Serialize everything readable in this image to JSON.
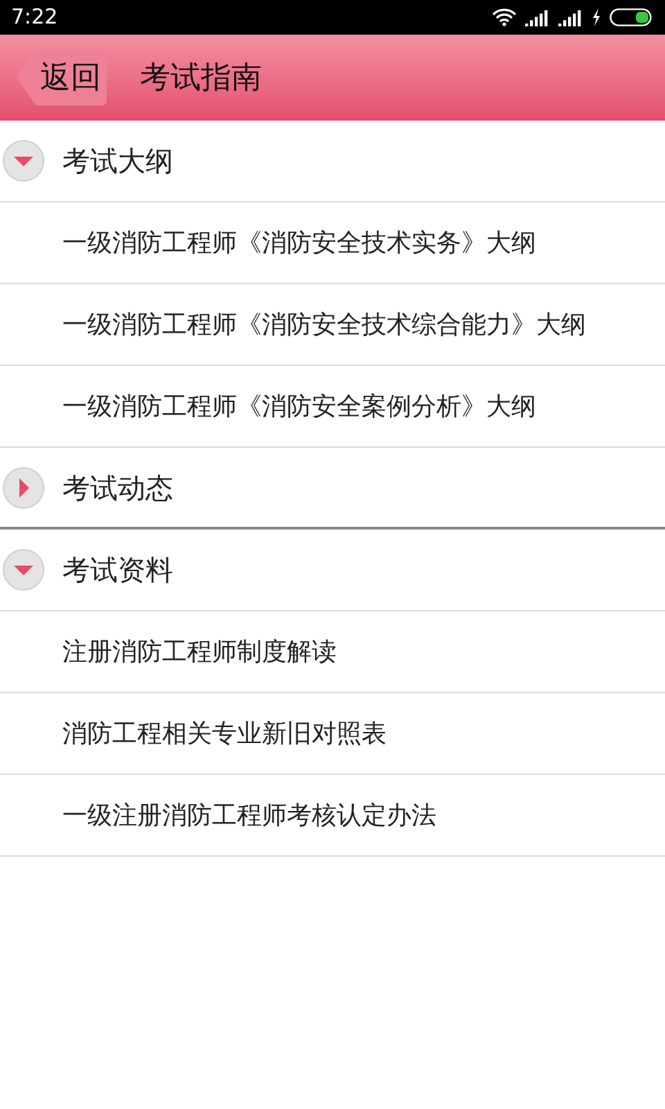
{
  "status_bar": {
    "time": "7:22"
  },
  "header": {
    "back": "返回",
    "title": "考试指南"
  },
  "groups": [
    {
      "label": "考试大纲",
      "expanded": true,
      "children": [
        {
          "label": "一级消防工程师《消防安全技术实务》大纲"
        },
        {
          "label": "一级消防工程师《消防安全技术综合能力》大纲"
        },
        {
          "label": "一级消防工程师《消防安全案例分析》大纲"
        }
      ]
    },
    {
      "label": "考试动态",
      "expanded": false
    },
    {
      "label": "考试资料",
      "expanded": true,
      "children": [
        {
          "label": "注册消防工程师制度解读"
        },
        {
          "label": "消防工程相关专业新旧对照表"
        },
        {
          "label": "一级注册消防工程师考核认定办法"
        }
      ]
    }
  ]
}
